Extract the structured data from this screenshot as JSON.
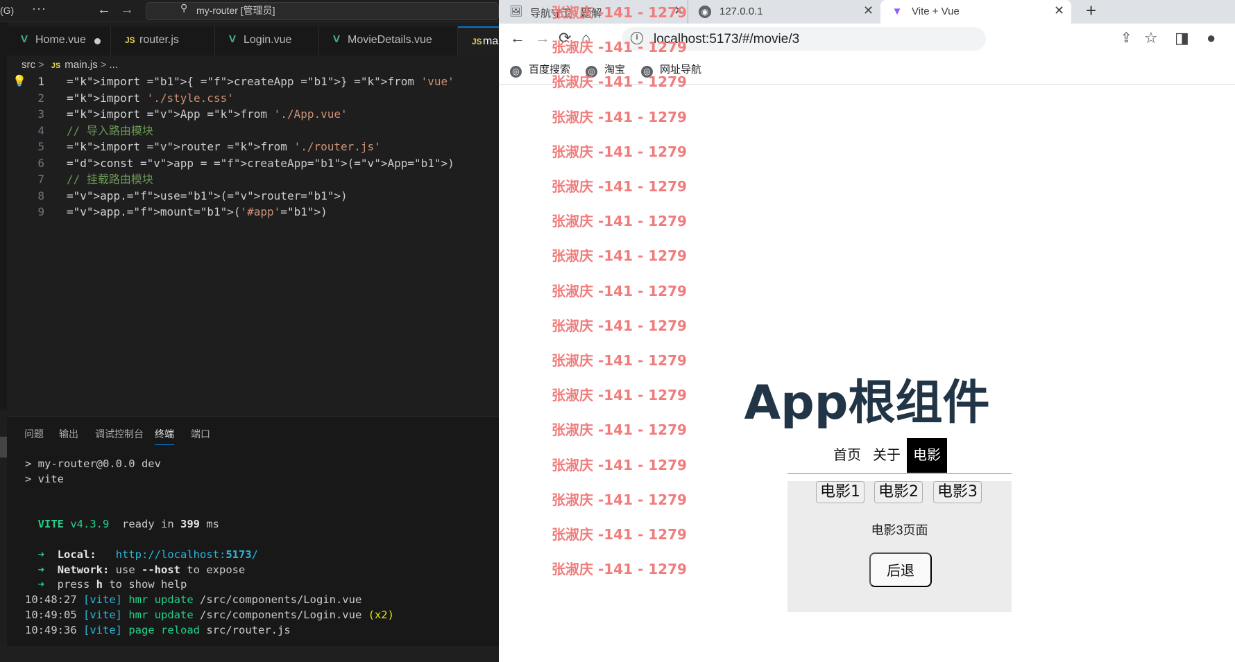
{
  "vscode": {
    "menu": "(G)",
    "more": "···",
    "search": "my-router [管理员]",
    "tabs": [
      "Home.vue",
      "router.js",
      "Login.vue",
      "MovieDetails.vue",
      "ma"
    ],
    "breadcrumb": {
      "folder": "src",
      "js_badge": "JS",
      "file": "main.js",
      "more": "..."
    },
    "code": [
      "import { createApp } from 'vue'",
      "import './style.css'",
      "import App from './App.vue'",
      "// 导入路由模块",
      "import router from './router.js'",
      "const app = createApp(App)",
      "// 挂载路由模块",
      "app.use(router)",
      "app.mount('#app')"
    ],
    "panel_tabs": [
      "问题",
      "输出",
      "调试控制台",
      "终端",
      "端口"
    ],
    "active_panel_tab": "终端",
    "terminal": [
      "> my-router@0.0.0 dev",
      "> vite",
      "",
      "",
      "  VITE v4.3.9  ready in 399 ms",
      "",
      "  ➜  Local:   http://localhost:5173/",
      "  ➜  Network: use --host to expose",
      "  ➜  press h to show help",
      "10:48:27 [vite] hmr update /src/components/Login.vue",
      "10:49:05 [vite] hmr update /src/components/Login.vue (x2)",
      "10:49:36 [vite] page reload src/router.js"
    ]
  },
  "browser": {
    "tabs": [
      {
        "title": "导航守卫 - 题解",
        "icon": "puzzle-favicon"
      },
      {
        "title": "127.0.0.1",
        "icon": "globe-favicon"
      },
      {
        "title": "Vite + Vue",
        "icon": "vite-favicon"
      }
    ],
    "url": "localhost:5173/#/movie/3",
    "bookmarks": [
      "百度搜索",
      "淘宝",
      "网址导航"
    ],
    "watermark": "张淑庆 -141 - 1279",
    "watermark_rows": 17
  },
  "app": {
    "title": "App根组件",
    "nav": [
      "首页",
      "关于",
      "电影"
    ],
    "active_nav": "电影",
    "movie_buttons": [
      "电影1",
      "电影2",
      "电影3"
    ],
    "movie_text": "电影3页面",
    "back_button": "后退"
  }
}
